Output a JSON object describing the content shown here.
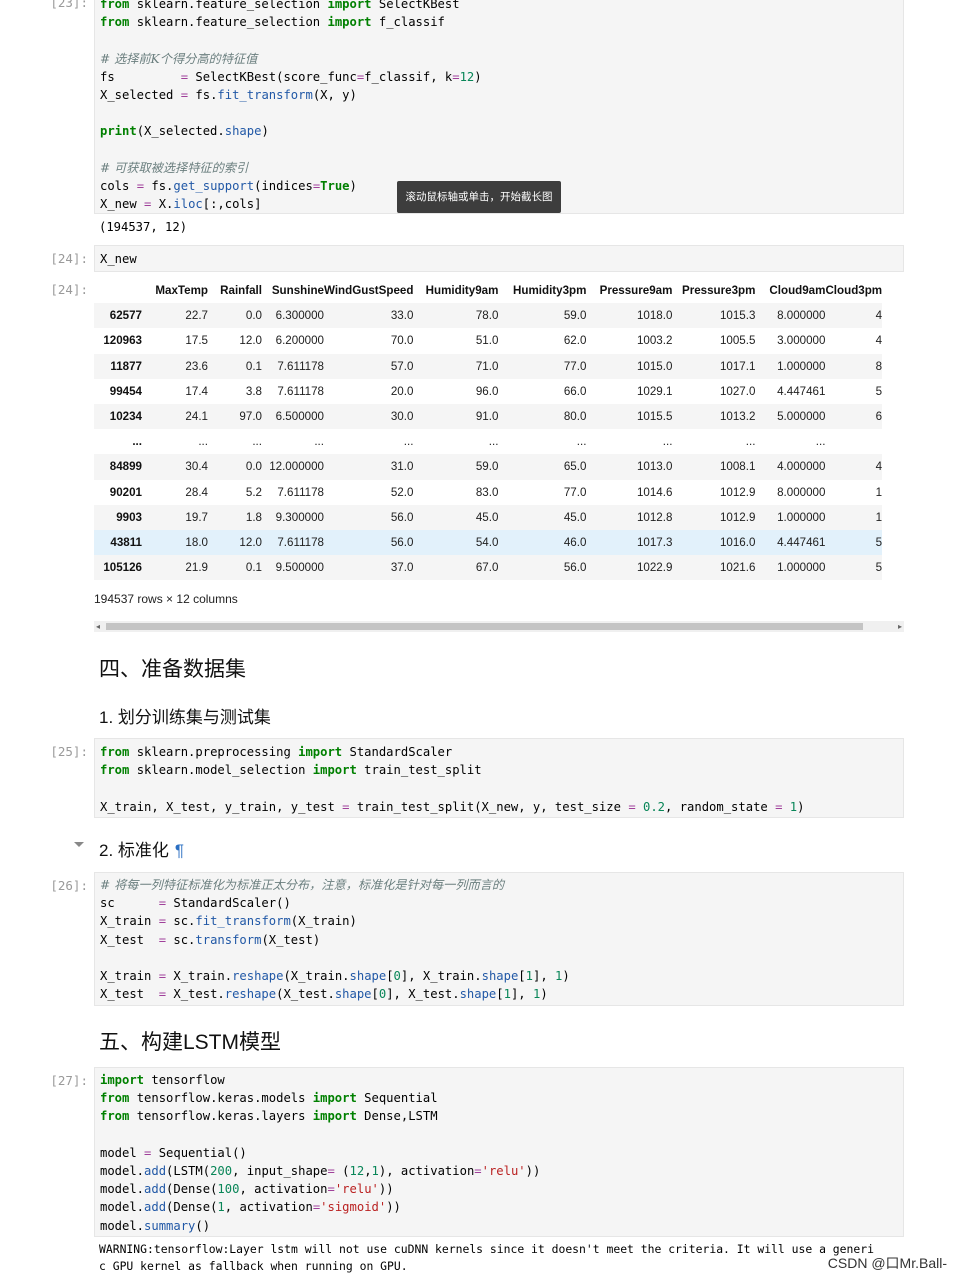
{
  "cell23": {
    "prompt": "[23]:",
    "lines": [
      [
        [
          "kw",
          "from"
        ],
        [
          "t",
          " sklearn.feature_selection "
        ],
        [
          "kw",
          "import"
        ],
        [
          "t",
          " SelectKBest"
        ]
      ],
      [
        [
          "kw",
          "from"
        ],
        [
          "t",
          " sklearn.feature_selection "
        ],
        [
          "kw",
          "import"
        ],
        [
          "t",
          " f_classif"
        ]
      ],
      [],
      [
        [
          "cm",
          "# 选择前K个得分高的特征值"
        ]
      ],
      [
        [
          "t",
          "fs         "
        ],
        [
          "op",
          "="
        ],
        [
          "t",
          " SelectKBest(score_func"
        ],
        [
          "op",
          "="
        ],
        [
          "t",
          "f_classif, k"
        ],
        [
          "op",
          "="
        ],
        [
          "num",
          "12"
        ],
        [
          "t",
          ")"
        ]
      ],
      [
        [
          "t",
          "X_selected "
        ],
        [
          "op",
          "="
        ],
        [
          "t",
          " fs."
        ],
        [
          "fn",
          "fit_transform"
        ],
        [
          "t",
          "(X, y)"
        ]
      ],
      [],
      [
        [
          "kw",
          "print"
        ],
        [
          "t",
          "(X_selected."
        ],
        [
          "fn",
          "shape"
        ],
        [
          "t",
          ")"
        ]
      ],
      [],
      [
        [
          "cm",
          "# 可获取被选择特征的索引"
        ]
      ],
      [
        [
          "t",
          "cols "
        ],
        [
          "op",
          "="
        ],
        [
          "t",
          " fs."
        ],
        [
          "fn",
          "get_support"
        ],
        [
          "t",
          "(indices"
        ],
        [
          "op",
          "="
        ],
        [
          "kw",
          "True"
        ],
        [
          "t",
          ")"
        ]
      ],
      [
        [
          "t",
          "X_new "
        ],
        [
          "op",
          "="
        ],
        [
          "t",
          " X."
        ],
        [
          "fn",
          "iloc"
        ],
        [
          "t",
          "[:,cols]"
        ]
      ]
    ],
    "output": "(194537, 12)"
  },
  "tooltip": "滚动鼠标轴或单击，开始截长图",
  "cell24": {
    "prompt_in": "[24]:",
    "code": "X_new",
    "prompt_out": "[24]:"
  },
  "dataframe": {
    "columns": [
      "",
      "MaxTemp",
      "Rainfall",
      "Sunshine",
      "WindGustSpeed",
      "Humidity9am",
      "Humidity3pm",
      "Pressure9am",
      "Pressure3pm",
      "Cloud9am",
      "Cloud3pm"
    ],
    "rows": [
      {
        "index": "62577",
        "values": [
          "22.7",
          "0.0",
          "6.300000",
          "33.0",
          "78.0",
          "59.0",
          "1018.0",
          "1015.3",
          "8.000000",
          "4"
        ]
      },
      {
        "index": "120963",
        "values": [
          "17.5",
          "12.0",
          "6.200000",
          "70.0",
          "51.0",
          "62.0",
          "1003.2",
          "1005.5",
          "3.000000",
          "4"
        ]
      },
      {
        "index": "11877",
        "values": [
          "23.6",
          "0.1",
          "7.611178",
          "57.0",
          "71.0",
          "77.0",
          "1015.0",
          "1017.1",
          "1.000000",
          "8"
        ]
      },
      {
        "index": "99454",
        "values": [
          "17.4",
          "3.8",
          "7.611178",
          "20.0",
          "96.0",
          "66.0",
          "1029.1",
          "1027.0",
          "4.447461",
          "5"
        ]
      },
      {
        "index": "10234",
        "values": [
          "24.1",
          "97.0",
          "6.500000",
          "30.0",
          "91.0",
          "80.0",
          "1015.5",
          "1013.2",
          "5.000000",
          "6"
        ]
      },
      {
        "index": "...",
        "values": [
          "...",
          "...",
          "...",
          "...",
          "...",
          "...",
          "...",
          "...",
          "...",
          ""
        ]
      },
      {
        "index": "84899",
        "values": [
          "30.4",
          "0.0",
          "12.000000",
          "31.0",
          "59.0",
          "65.0",
          "1013.0",
          "1008.1",
          "4.000000",
          "4"
        ]
      },
      {
        "index": "90201",
        "values": [
          "28.4",
          "5.2",
          "7.611178",
          "52.0",
          "83.0",
          "77.0",
          "1014.6",
          "1012.9",
          "8.000000",
          "1"
        ]
      },
      {
        "index": "9903",
        "values": [
          "19.7",
          "1.8",
          "9.300000",
          "56.0",
          "45.0",
          "45.0",
          "1012.8",
          "1012.9",
          "1.000000",
          "1"
        ]
      },
      {
        "index": "43811",
        "values": [
          "18.0",
          "12.0",
          "7.611178",
          "56.0",
          "54.0",
          "46.0",
          "1017.3",
          "1016.0",
          "4.447461",
          "5"
        ],
        "highlight": true
      },
      {
        "index": "105126",
        "values": [
          "21.9",
          "0.1",
          "9.500000",
          "37.0",
          "67.0",
          "56.0",
          "1022.9",
          "1021.6",
          "1.000000",
          "5"
        ]
      }
    ],
    "shape_note": "194537 rows × 12 columns"
  },
  "section4": {
    "title": "四、准备数据集",
    "sub1": "1. 划分训练集与测试集"
  },
  "cell25": {
    "prompt": "[25]:",
    "lines": [
      [
        [
          "kw",
          "from"
        ],
        [
          "t",
          " sklearn.preprocessing "
        ],
        [
          "kw",
          "import"
        ],
        [
          "t",
          " StandardScaler"
        ]
      ],
      [
        [
          "kw",
          "from"
        ],
        [
          "t",
          " sklearn.model_selection "
        ],
        [
          "kw",
          "import"
        ],
        [
          "t",
          " train_test_split"
        ]
      ],
      [],
      [
        [
          "t",
          "X_train, X_test, y_train, y_test "
        ],
        [
          "op",
          "="
        ],
        [
          "t",
          " train_test_split(X_new, y, test_size "
        ],
        [
          "op",
          "="
        ],
        [
          "t",
          " "
        ],
        [
          "num",
          "0.2"
        ],
        [
          "t",
          ", random_state "
        ],
        [
          "op",
          "="
        ],
        [
          "t",
          " "
        ],
        [
          "num",
          "1"
        ],
        [
          "t",
          ")"
        ]
      ]
    ]
  },
  "sub2": {
    "title": "2. 标准化",
    "pilcrow": "¶"
  },
  "cell26": {
    "prompt": "[26]:",
    "lines": [
      [
        [
          "cm",
          "# 将每一列特征标准化为标准正太分布，注意，标准化是针对每一列而言的"
        ]
      ],
      [
        [
          "t",
          "sc      "
        ],
        [
          "op",
          "="
        ],
        [
          "t",
          " StandardScaler()"
        ]
      ],
      [
        [
          "t",
          "X_train "
        ],
        [
          "op",
          "="
        ],
        [
          "t",
          " sc."
        ],
        [
          "fn",
          "fit_transform"
        ],
        [
          "t",
          "(X_train)"
        ]
      ],
      [
        [
          "t",
          "X_test  "
        ],
        [
          "op",
          "="
        ],
        [
          "t",
          " sc."
        ],
        [
          "fn",
          "transform"
        ],
        [
          "t",
          "(X_test)"
        ]
      ],
      [],
      [
        [
          "t",
          "X_train "
        ],
        [
          "op",
          "="
        ],
        [
          "t",
          " X_train."
        ],
        [
          "fn",
          "reshape"
        ],
        [
          "t",
          "(X_train."
        ],
        [
          "fn",
          "shape"
        ],
        [
          "t",
          "["
        ],
        [
          "num",
          "0"
        ],
        [
          "t",
          "], X_train."
        ],
        [
          "fn",
          "shape"
        ],
        [
          "t",
          "["
        ],
        [
          "num",
          "1"
        ],
        [
          "t",
          "], "
        ],
        [
          "num",
          "1"
        ],
        [
          "t",
          ")"
        ]
      ],
      [
        [
          "t",
          "X_test  "
        ],
        [
          "op",
          "="
        ],
        [
          "t",
          " X_test."
        ],
        [
          "fn",
          "reshape"
        ],
        [
          "t",
          "(X_test."
        ],
        [
          "fn",
          "shape"
        ],
        [
          "t",
          "["
        ],
        [
          "num",
          "0"
        ],
        [
          "t",
          "], X_test."
        ],
        [
          "fn",
          "shape"
        ],
        [
          "t",
          "["
        ],
        [
          "num",
          "1"
        ],
        [
          "t",
          "], "
        ],
        [
          "num",
          "1"
        ],
        [
          "t",
          ")"
        ]
      ]
    ]
  },
  "section5": {
    "title": "五、构建LSTM模型"
  },
  "cell27": {
    "prompt": "[27]:",
    "lines": [
      [
        [
          "kw",
          "import"
        ],
        [
          "t",
          " tensorflow"
        ]
      ],
      [
        [
          "kw",
          "from"
        ],
        [
          "t",
          " tensorflow.keras.models "
        ],
        [
          "kw",
          "import"
        ],
        [
          "t",
          " Sequential"
        ]
      ],
      [
        [
          "kw",
          "from"
        ],
        [
          "t",
          " tensorflow.keras.layers "
        ],
        [
          "kw",
          "import"
        ],
        [
          "t",
          " Dense,LSTM"
        ]
      ],
      [],
      [
        [
          "t",
          "model "
        ],
        [
          "op",
          "="
        ],
        [
          "t",
          " Sequential()"
        ]
      ],
      [
        [
          "t",
          "model."
        ],
        [
          "fn",
          "add"
        ],
        [
          "t",
          "(LSTM("
        ],
        [
          "num",
          "200"
        ],
        [
          "t",
          ", input_shape"
        ],
        [
          "op",
          "="
        ],
        [
          "t",
          " ("
        ],
        [
          "num",
          "12"
        ],
        [
          "t",
          ","
        ],
        [
          "num",
          "1"
        ],
        [
          "t",
          "), activation"
        ],
        [
          "op",
          "="
        ],
        [
          "str",
          "'relu'"
        ],
        [
          "t",
          "))"
        ]
      ],
      [
        [
          "t",
          "model."
        ],
        [
          "fn",
          "add"
        ],
        [
          "t",
          "(Dense("
        ],
        [
          "num",
          "100"
        ],
        [
          "t",
          ", activation"
        ],
        [
          "op",
          "="
        ],
        [
          "str",
          "'relu'"
        ],
        [
          "t",
          "))"
        ]
      ],
      [
        [
          "t",
          "model."
        ],
        [
          "fn",
          "add"
        ],
        [
          "t",
          "(Dense("
        ],
        [
          "num",
          "1"
        ],
        [
          "t",
          ", activation"
        ],
        [
          "op",
          "="
        ],
        [
          "str",
          "'sigmoid'"
        ],
        [
          "t",
          "))"
        ]
      ],
      [
        [
          "t",
          "model."
        ],
        [
          "fn",
          "summary"
        ],
        [
          "t",
          "()"
        ]
      ]
    ],
    "output_lines": [
      "WARNING:tensorflow:Layer lstm will not use cuDNN kernels since it doesn't meet the criteria. It will use a generi",
      "c GPU kernel as fallback when running on GPU."
    ]
  },
  "watermark": "CSDN @口Mr.Ball-"
}
